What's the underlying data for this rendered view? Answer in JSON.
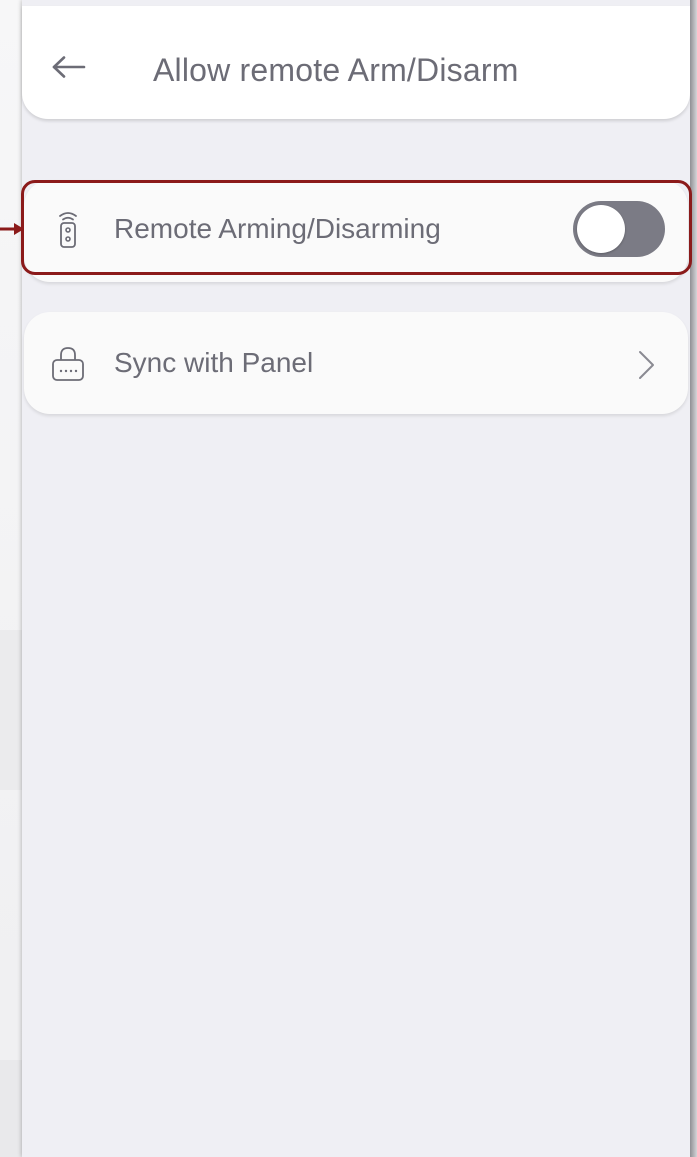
{
  "header": {
    "back_icon": "arrow-left-icon",
    "title": "Allow remote Arm/Disarm"
  },
  "settings": {
    "remote": {
      "icon": "remote-control-icon",
      "label": "Remote Arming/Disarming",
      "toggle_on": false
    },
    "sync": {
      "icon": "keypad-lock-icon",
      "label": "Sync with Panel",
      "chevron_icon": "chevron-right-icon"
    }
  },
  "colors": {
    "background": "#efeff4",
    "card": "#fafafa",
    "text": "#6c6c76",
    "toggle_track": "#7b7b85",
    "highlight": "#8b1a1a"
  }
}
